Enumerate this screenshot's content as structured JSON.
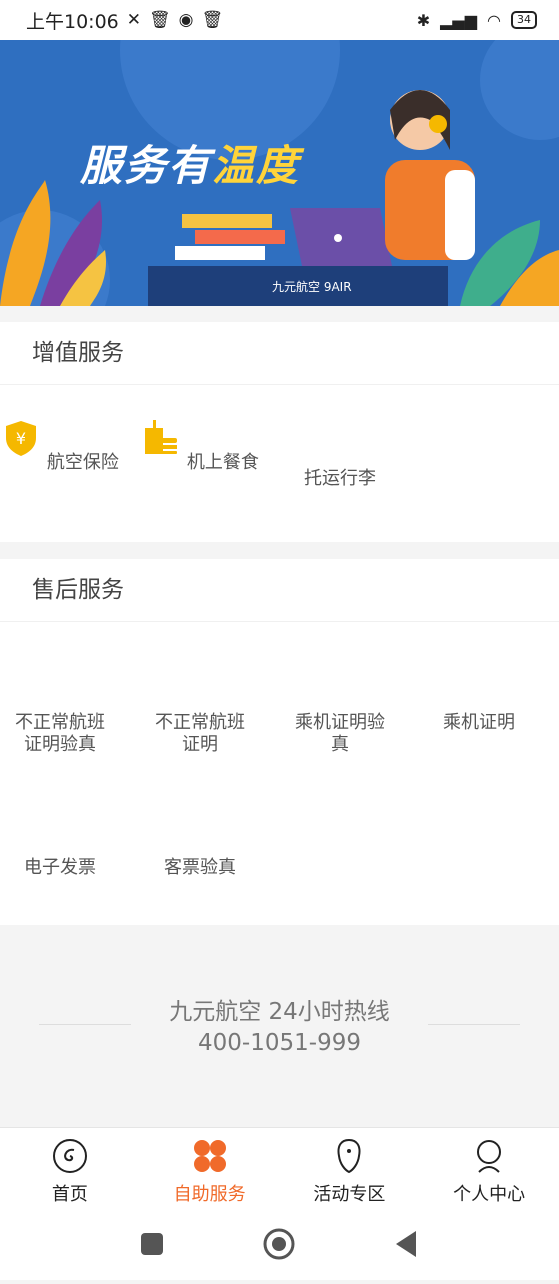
{
  "status_bar": {
    "time": "上午10:06",
    "battery": "34"
  },
  "banner": {
    "title_main": "服务有",
    "title_highlight": "温度",
    "brand": "九元航空 9AIR"
  },
  "value_added": {
    "title": "增值服务",
    "items": [
      {
        "label": "航空保险",
        "icon": "insurance-shield-icon"
      },
      {
        "label": "机上餐食",
        "icon": "meal-icon"
      },
      {
        "label": "托运行李",
        "icon": "luggage-icon"
      }
    ]
  },
  "after_sales": {
    "title": "售后服务",
    "items": [
      {
        "label": "不正常航班证明验真"
      },
      {
        "label": "不正常航班证明"
      },
      {
        "label": "乘机证明验真"
      },
      {
        "label": "乘机证明"
      },
      {
        "label": "电子发票"
      },
      {
        "label": "客票验真"
      }
    ]
  },
  "hotline": {
    "title": "九元航空 24小时热线",
    "number": "400-1051-999"
  },
  "tabbar": {
    "tabs": [
      {
        "label": "首页",
        "icon": "home-icon"
      },
      {
        "label": "自助服务",
        "icon": "self-service-icon",
        "active": true
      },
      {
        "label": "活动专区",
        "icon": "activity-icon"
      },
      {
        "label": "个人中心",
        "icon": "profile-icon"
      }
    ]
  },
  "colors": {
    "accent": "#f06a2a",
    "banner_bg": "#2f6fc0",
    "icon_yellow": "#f5b800"
  }
}
